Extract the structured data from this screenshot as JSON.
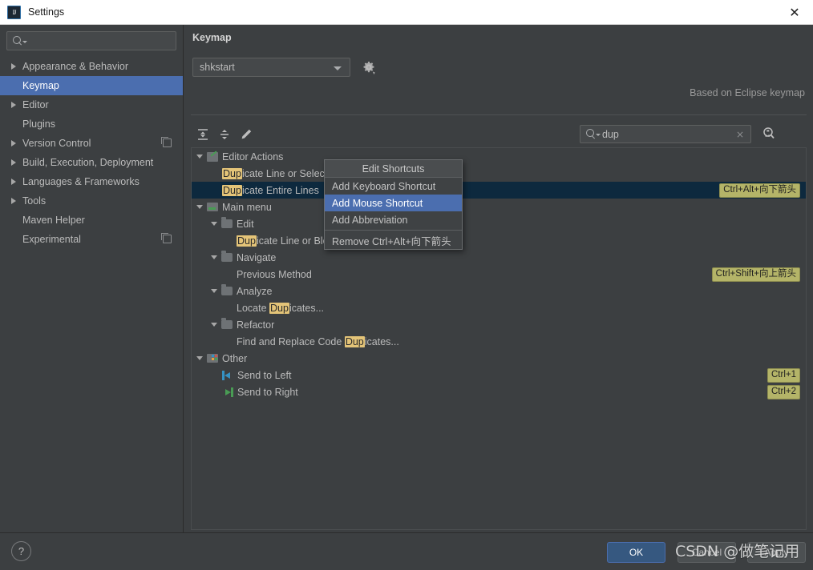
{
  "window": {
    "title": "Settings",
    "app_icon": "intellij-idea-icon",
    "close_icon": "close-icon"
  },
  "sidebar": {
    "search": {
      "value": "",
      "placeholder": "",
      "icon": "search-icon"
    },
    "items": [
      {
        "label": "Appearance & Behavior",
        "expandable": true,
        "selected": false,
        "badge": false
      },
      {
        "label": "Keymap",
        "expandable": false,
        "selected": true,
        "badge": false
      },
      {
        "label": "Editor",
        "expandable": true,
        "selected": false,
        "badge": false
      },
      {
        "label": "Plugins",
        "expandable": false,
        "selected": false,
        "badge": false
      },
      {
        "label": "Version Control",
        "expandable": true,
        "selected": false,
        "badge": true
      },
      {
        "label": "Build, Execution, Deployment",
        "expandable": true,
        "selected": false,
        "badge": false
      },
      {
        "label": "Languages & Frameworks",
        "expandable": true,
        "selected": false,
        "badge": false
      },
      {
        "label": "Tools",
        "expandable": true,
        "selected": false,
        "badge": false
      },
      {
        "label": "Maven Helper",
        "expandable": false,
        "selected": false,
        "badge": false
      },
      {
        "label": "Experimental",
        "expandable": false,
        "selected": false,
        "badge": true
      }
    ]
  },
  "main": {
    "panel_title": "Keymap",
    "keymap_select": {
      "value": "shkstart",
      "caret_icon": "chevron-down-icon"
    },
    "gear_icon": "gear-icon",
    "based_on": "Based on Eclipse keymap",
    "toolbar": {
      "expand_all": "expand-all-icon",
      "collapse_all": "collapse-all-icon",
      "edit": "pencil-edit-icon"
    },
    "search": {
      "value": "dup",
      "placeholder": "",
      "icon": "search-icon",
      "clear_label": "×"
    },
    "find_shortcut_icon": "find-by-shortcut-icon"
  },
  "tree": {
    "highlight_term": "Dup",
    "rows": [
      {
        "indent": 0,
        "arrow": "down",
        "icon": "editor-actions-icon",
        "pre": "",
        "hl": "",
        "post": "Editor Actions",
        "shortcut": "",
        "selected": false
      },
      {
        "indent": 1,
        "arrow": "none",
        "icon": "none",
        "pre": "",
        "hl": "Dup",
        "post": "icate Line or Selection",
        "shortcut": "",
        "selected": false
      },
      {
        "indent": 1,
        "arrow": "none",
        "icon": "none",
        "pre": "",
        "hl": "Dup",
        "post": "icate Entire Lines",
        "shortcut": "Ctrl+Alt+向下箭头",
        "selected": true
      },
      {
        "indent": 0,
        "arrow": "down",
        "icon": "main-menu-icon",
        "pre": "",
        "hl": "",
        "post": "Main menu",
        "shortcut": "",
        "selected": false
      },
      {
        "indent": 1,
        "arrow": "down",
        "icon": "folder-icon",
        "pre": "",
        "hl": "",
        "post": "Edit",
        "shortcut": "",
        "selected": false
      },
      {
        "indent": 2,
        "arrow": "none",
        "icon": "none",
        "pre": "",
        "hl": "Dup",
        "post": "icate Line or Block",
        "shortcut": "",
        "selected": false
      },
      {
        "indent": 1,
        "arrow": "down",
        "icon": "folder-icon",
        "pre": "",
        "hl": "",
        "post": "Navigate",
        "shortcut": "",
        "selected": false
      },
      {
        "indent": 2,
        "arrow": "none",
        "icon": "none",
        "pre": "Previous Method",
        "hl": "",
        "post": "",
        "shortcut": "Ctrl+Shift+向上箭头",
        "selected": false
      },
      {
        "indent": 1,
        "arrow": "down",
        "icon": "folder-icon",
        "pre": "",
        "hl": "",
        "post": "Analyze",
        "shortcut": "",
        "selected": false
      },
      {
        "indent": 2,
        "arrow": "none",
        "icon": "none",
        "pre": "Locate ",
        "hl": "Dup",
        "post": "icates...",
        "shortcut": "",
        "selected": false
      },
      {
        "indent": 1,
        "arrow": "down",
        "icon": "folder-icon",
        "pre": "",
        "hl": "",
        "post": "Refactor",
        "shortcut": "",
        "selected": false
      },
      {
        "indent": 2,
        "arrow": "none",
        "icon": "none",
        "pre": "Find and Replace Code ",
        "hl": "Dup",
        "post": "icates...",
        "shortcut": "",
        "selected": false
      },
      {
        "indent": 0,
        "arrow": "down",
        "icon": "other-icon",
        "pre": "",
        "hl": "",
        "post": "Other",
        "shortcut": "",
        "selected": false
      },
      {
        "indent": 1,
        "arrow": "none",
        "icon": "send-to-left-icon",
        "pre": "Send to Left",
        "hl": "",
        "post": "",
        "shortcut": "Ctrl+1",
        "selected": false
      },
      {
        "indent": 1,
        "arrow": "none",
        "icon": "send-to-right-icon",
        "pre": "Send to Right",
        "hl": "",
        "post": "",
        "shortcut": "Ctrl+2",
        "selected": false
      }
    ]
  },
  "context_menu": {
    "title": "Edit Shortcuts",
    "items": [
      {
        "label": "Add Keyboard Shortcut",
        "highlight": false,
        "separator_after": false
      },
      {
        "label": "Add Mouse Shortcut",
        "highlight": true,
        "separator_after": false
      },
      {
        "label": "Add Abbreviation",
        "highlight": false,
        "separator_after": true
      },
      {
        "label": "Remove Ctrl+Alt+向下箭头",
        "highlight": false,
        "separator_after": false
      }
    ]
  },
  "footer": {
    "help_label": "?",
    "ok_label": "OK",
    "cancel_label": "Cancel",
    "apply_label": "Apply"
  },
  "watermark": {
    "text": "CSDN @做笔记用"
  },
  "colors": {
    "window_bg": "#3c3f41",
    "titlebar_bg": "#ffffff",
    "selection_blue": "#4b6eaf",
    "tree_selection": "#0d293e",
    "shortcut_badge": "#b4b468",
    "search_highlight": "#e4c478",
    "ok_button": "#365880",
    "text": "#bbbbbb"
  }
}
